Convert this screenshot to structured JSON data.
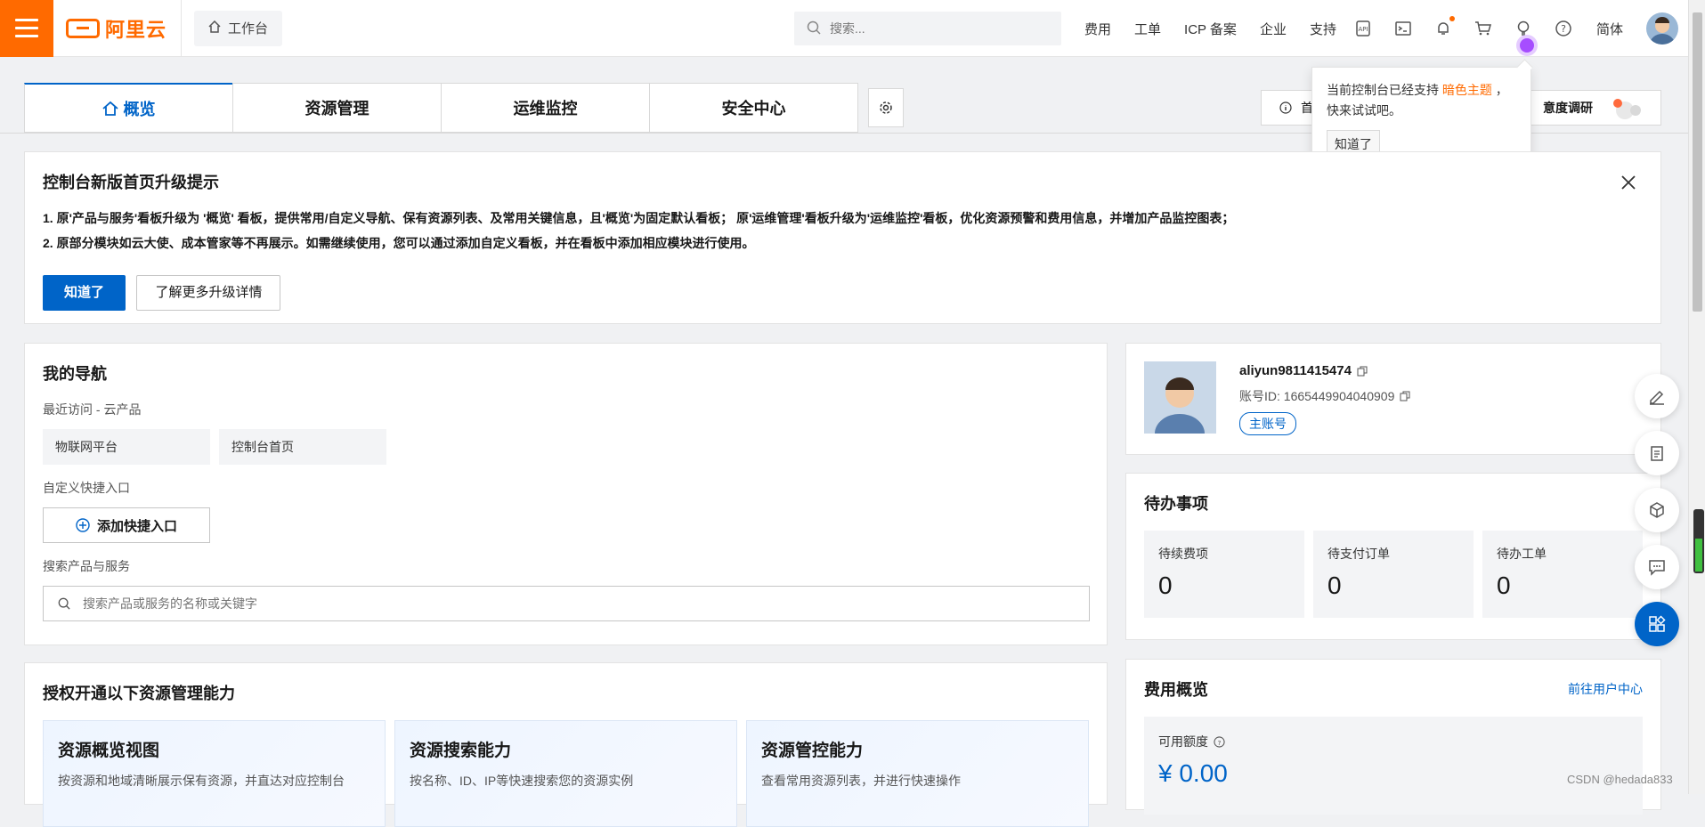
{
  "header": {
    "logo_text": "阿里云",
    "workbench_label": "工作台",
    "search_placeholder": "搜索...",
    "nav": [
      "费用",
      "工单",
      "ICP 备案",
      "企业",
      "支持"
    ],
    "language": "简体",
    "icons": [
      "api-icon",
      "terminal-icon",
      "bell-icon",
      "cart-icon",
      "lightbulb-icon",
      "help-icon"
    ]
  },
  "tabs": {
    "items": [
      "概览",
      "资源管理",
      "运维监控",
      "安全中心"
    ],
    "active_index": 0,
    "feedback_prefix": "首",
    "feedback_label": "意度调研"
  },
  "popover": {
    "text_prefix": "当前控制台已经支持",
    "text_accent": "暗色主题",
    "text_suffix": "，快来试试吧。",
    "button_label": "知道了"
  },
  "notice": {
    "title": "控制台新版首页升级提示",
    "line1": "1. 原'产品与服务'看板升级为 '概览' 看板，提供常用/自定义导航、保有资源列表、及常用关键信息，且'概览'为固定默认看板；  原'运维管理'看板升级为'运维监控'看板，优化资源预警和费用信息，并增加产品监控图表；",
    "line2": "2. 原部分模块如云大使、成本管家等不再展示。如需继续使用，您可以通过添加自定义看板，并在看板中添加相应模块进行使用。",
    "confirm_label": "知道了",
    "more_label": "了解更多升级详情"
  },
  "my_nav": {
    "title": "我的导航",
    "recent_label": "最近访问 - 云产品",
    "recent_items": [
      "物联网平台",
      "控制台首页"
    ],
    "custom_label": "自定义快捷入口",
    "add_label": "添加快捷入口",
    "search_label": "搜索产品与服务",
    "search_placeholder": "搜索产品或服务的名称或关键字"
  },
  "auth": {
    "title": "授权开通以下资源管理能力",
    "cards": [
      {
        "title": "资源概览视图",
        "desc": "按资源和地域清晰展示保有资源，并直达对应控制台"
      },
      {
        "title": "资源搜索能力",
        "desc": "按名称、ID、IP等快速搜索您的资源实例"
      },
      {
        "title": "资源管控能力",
        "desc": "查看常用资源列表，并进行快速操作"
      }
    ]
  },
  "account": {
    "username": "aliyun9811415474",
    "account_id": "账号ID: 1665449904040909",
    "badge": "主账号"
  },
  "todo": {
    "title": "待办事项",
    "items": [
      {
        "label": "待续费项",
        "value": "0"
      },
      {
        "label": "待支付订单",
        "value": "0"
      },
      {
        "label": "待办工单",
        "value": "0"
      }
    ]
  },
  "fee": {
    "title": "费用概览",
    "link": "前往用户中心",
    "available_label": "可用额度",
    "amount": "¥ 0.00"
  },
  "side_tools": [
    "edit-icon",
    "clipboard-icon",
    "cube-icon",
    "chat-icon",
    "apps-icon"
  ],
  "meter": {
    "level_percent": 55
  },
  "watermark": "CSDN @hedada833"
}
